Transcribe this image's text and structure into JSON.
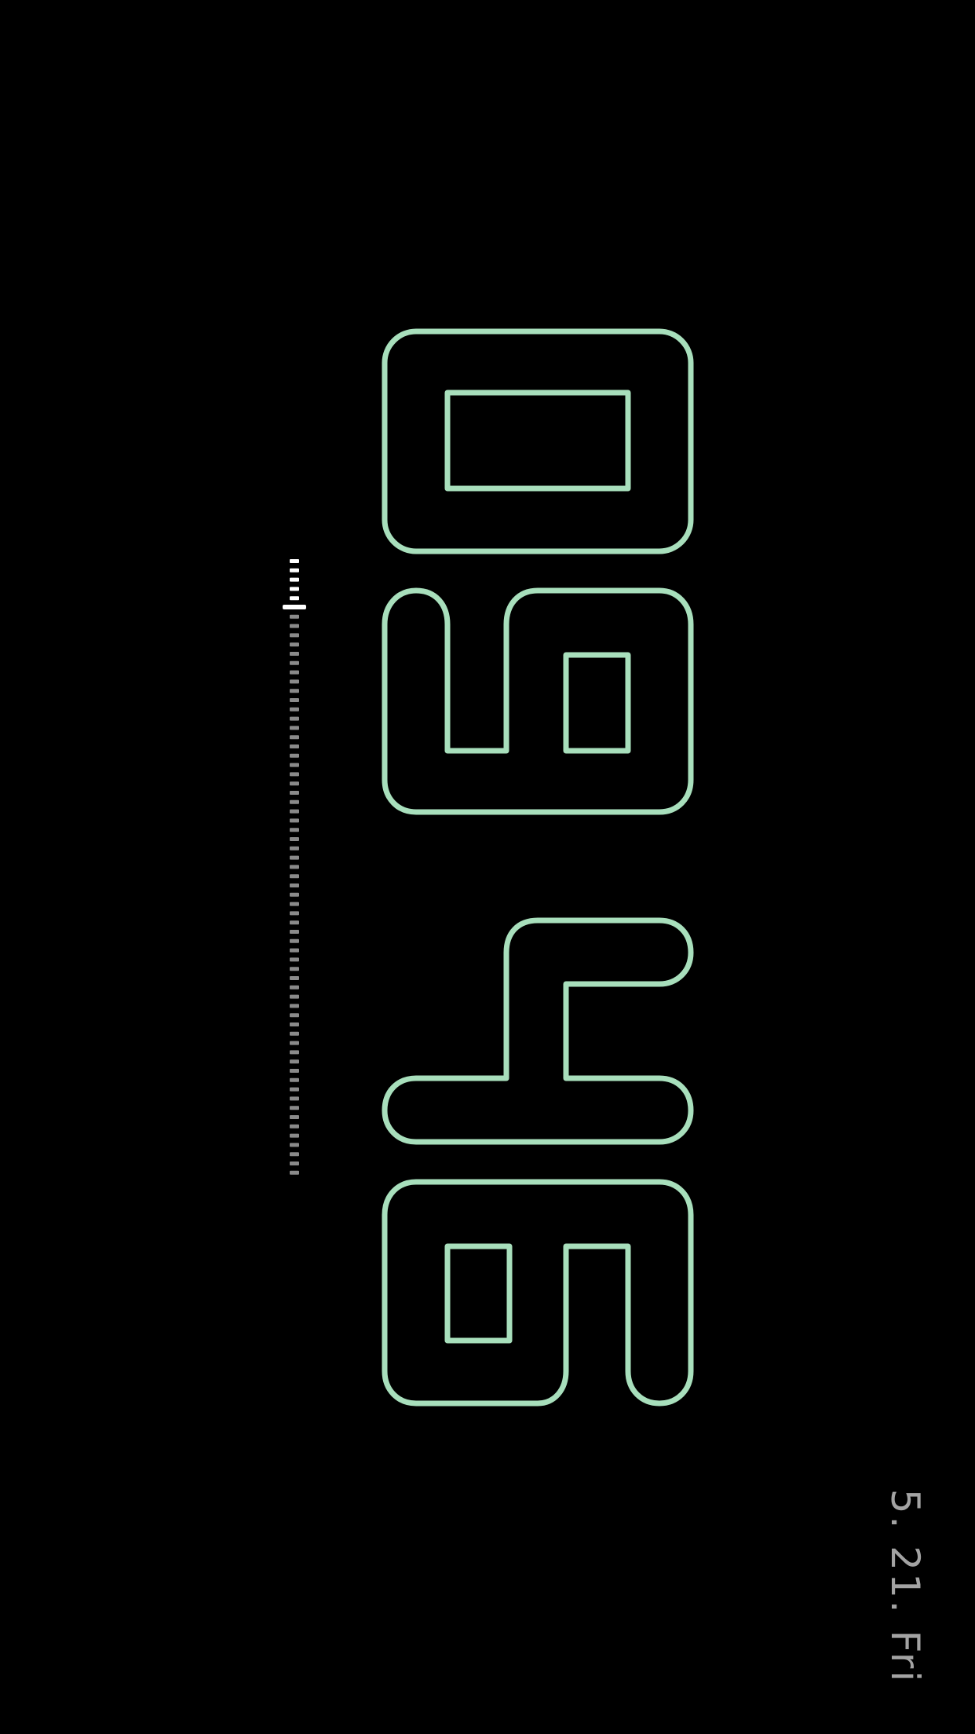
{
  "clock": {
    "hours": "09",
    "minutes": "46",
    "orientation": "rotated-90-clockwise",
    "style": "outlined-digits"
  },
  "date": {
    "label": "5. 21. Fri"
  },
  "seconds_indicator": {
    "style": "dashed-ticks",
    "elapsed_fraction": 0.07
  },
  "colors": {
    "background": "#000000",
    "digit_stroke": "#a8dfbc",
    "date_text": "#a3a3a3",
    "tick_elapsed": "#ffffff",
    "tick_remaining": "#8a8a8a"
  }
}
